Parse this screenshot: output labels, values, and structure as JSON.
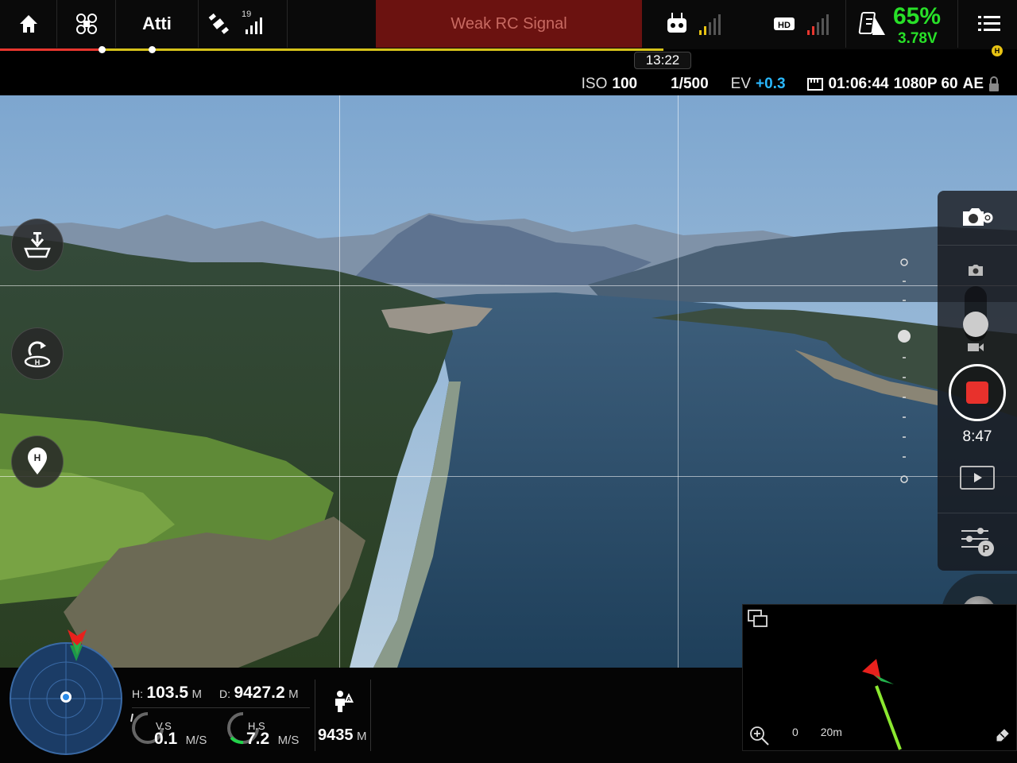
{
  "top_bar": {
    "flight_mode": "Atti",
    "gps_satellites": "19",
    "warning_text": "Weak RC Signal",
    "battery_percent": "65%",
    "battery_voltage": "3.78V",
    "hd_label": "HD",
    "menu_badge": "H",
    "flight_time": "13:22",
    "battery_progress_red_fraction": 0.153,
    "colors": {
      "warning_bg": "#6b1210",
      "battery_text": "#28e028",
      "ev_value": "#2ab8ff"
    }
  },
  "camera_info": {
    "iso_label": "ISO",
    "iso_value": "100",
    "shutter": "1/500",
    "ev_label": "EV",
    "ev_value": "+0.3",
    "record_remaining": "01:06:44",
    "resolution": "1080P 60",
    "exposure_mode": "AE"
  },
  "left_buttons": [
    "takeoff-land-icon",
    "return-home-icon",
    "home-point-icon"
  ],
  "right_panel": {
    "record_time": "8:47",
    "icons": [
      "camera-settings-icon",
      "photo-mode-icon",
      "video-mode-icon",
      "record-button",
      "playback-icon",
      "parameters-icon",
      "exposure-lock-icon"
    ]
  },
  "telemetry": {
    "height_label": "H:",
    "height_value": "103.5",
    "height_unit": "M",
    "distance_label": "D:",
    "distance_value": "9427.2",
    "distance_unit": "M",
    "vs_label": "V.S",
    "vs_value": "0.1",
    "vs_unit": "M/S",
    "hs_label": "H.S",
    "hs_value": "7.2",
    "hs_unit": "M/S",
    "rc_distance_value": "9435",
    "rc_distance_unit": "M"
  },
  "minimap": {
    "scale_start": "0",
    "scale_end": "20m"
  }
}
